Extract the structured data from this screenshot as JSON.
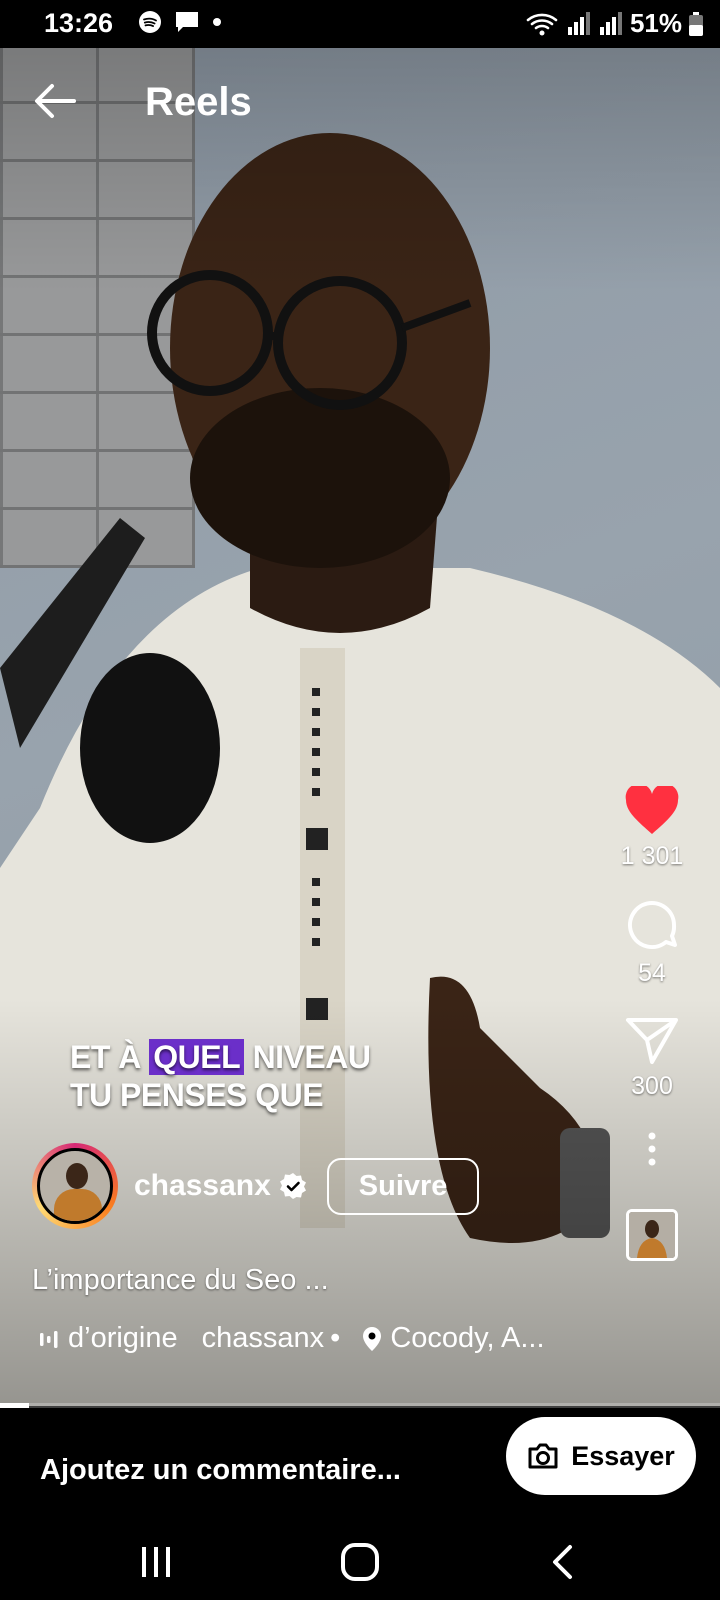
{
  "status_bar": {
    "time": "13:26",
    "battery": "51%",
    "icons_left": [
      "spotify-icon",
      "chat-icon",
      "dot-icon"
    ],
    "icons_right": [
      "wifi-icon",
      "signal-icon",
      "signal-icon",
      "battery-icon"
    ]
  },
  "header": {
    "title": "Reels",
    "back_icon": "back-arrow-icon"
  },
  "video": {
    "caption_line1_pre": "ET À ",
    "caption_line1_hl": "QUEL",
    "caption_line1_post": " NIVEAU",
    "caption_line2": "TU PENSES QUE",
    "progress": 0.04
  },
  "actions": {
    "likes": "1 301",
    "comments": "54",
    "shares": "300",
    "like_color": "#ff3040"
  },
  "author": {
    "username": "chassanx",
    "follow_label": "Suivre"
  },
  "description": "L’importance du Seo ...",
  "meta": {
    "audio": "d’origine",
    "audio_author": "chassanx",
    "separator": "•",
    "location": "Cocody, A..."
  },
  "comment_bar": {
    "placeholder": "Ajoutez un commentaire...",
    "try_label": "Essayer"
  },
  "nav": {
    "buttons": [
      "recent-apps-icon",
      "home-icon",
      "back-icon"
    ]
  }
}
